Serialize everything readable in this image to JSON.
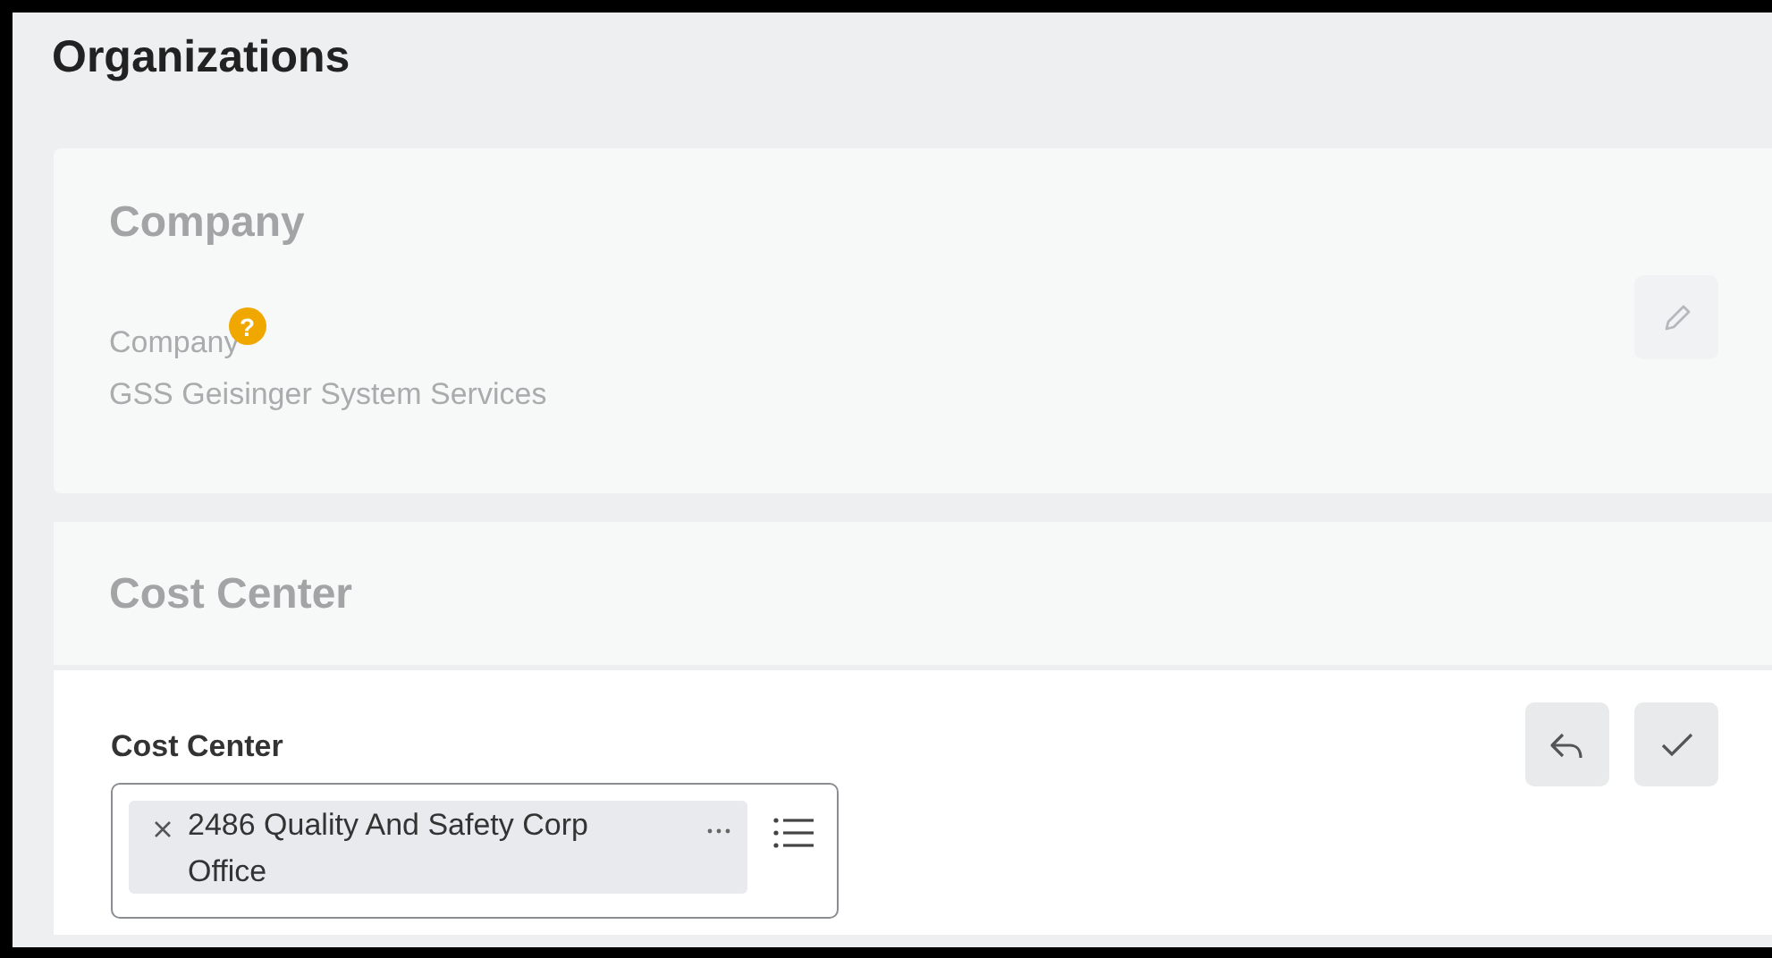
{
  "page_title": "Organizations",
  "company_section": {
    "heading": "Company",
    "field_label": "Company",
    "help_badge": "?",
    "value": "GSS Geisinger System Services"
  },
  "cost_center_section": {
    "heading": "Cost Center",
    "field_label": "Cost Center",
    "selected_values": [
      "2486 Quality And Safety Corp Office"
    ]
  }
}
